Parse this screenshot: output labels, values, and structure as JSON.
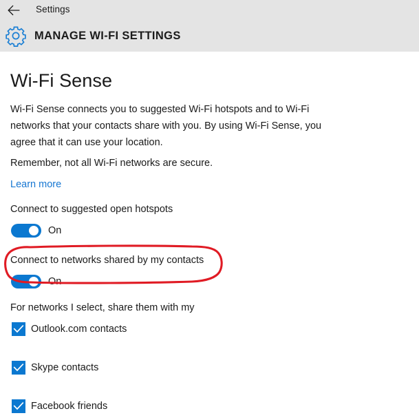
{
  "window": {
    "titlebar_label": "Settings",
    "back_icon": "back-arrow-icon"
  },
  "header": {
    "icon": "gear-icon",
    "title": "MANAGE WI-FI SETTINGS",
    "background_color": "#e4e4e4"
  },
  "colors": {
    "accent": "#0b78d0",
    "link": "#1777d2",
    "annotation": "#e01b24",
    "text": "#1a1a1a",
    "header_bg": "#e4e4e4"
  },
  "main": {
    "section_title": "Wi-Fi Sense",
    "description": "Wi-Fi Sense connects you to suggested Wi-Fi hotspots and to Wi-Fi networks that your contacts share with you. By using Wi-Fi Sense, you agree that it can use your location.",
    "note": "Remember, not all Wi-Fi networks are secure.",
    "learn_more": "Learn more",
    "settings": [
      {
        "label": "Connect to suggested open hotspots",
        "state": "On",
        "checked": true,
        "highlighted": false
      },
      {
        "label": "Connect to networks shared by my contacts",
        "state": "On",
        "checked": true,
        "highlighted": true
      }
    ],
    "share_heading": "For networks I select, share them with my",
    "share_options": [
      {
        "label": "Outlook.com contacts",
        "checked": true
      },
      {
        "label": "Skype contacts",
        "checked": true
      },
      {
        "label": "Facebook friends",
        "checked": true
      }
    ]
  },
  "annotation": {
    "type": "hand-drawn-ellipse",
    "color": "#e01b24",
    "targets": "Connect to networks shared by my contacts"
  }
}
